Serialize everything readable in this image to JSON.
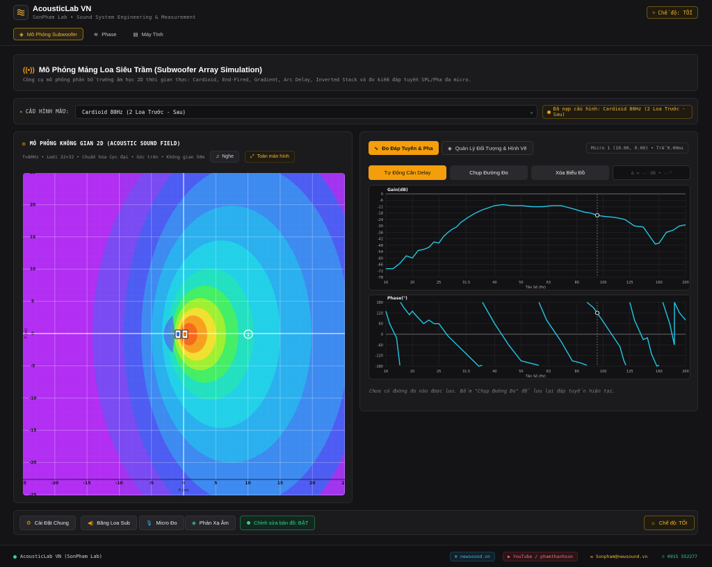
{
  "app": {
    "title": "AcousticLab VN",
    "subtitle": "SonPham Lab • Sound System Engineering & Measurement",
    "mode_label": "Chế độ: TỐI"
  },
  "nav": {
    "tabs": [
      {
        "label": "Mô Phỏng Subwoofer",
        "icon": "layers-icon",
        "active": true
      },
      {
        "label": "Phase",
        "icon": "wave-icon",
        "active": false
      },
      {
        "label": "Máy Tính",
        "icon": "calculator-icon",
        "active": false
      }
    ]
  },
  "header": {
    "title": "Mô Phỏng Mảng Loa Siêu Trầm (Subwoofer Array Simulation)",
    "description": "Công cụ mô phỏng phân bố trường âm học 2D thời gian thực: Cardioid, End-Fired, Gradient, Arc Delay, Inverted Stack và đo kiểm đáp tuyến SPL/Pha đa micro."
  },
  "config": {
    "label": "CẤU HÌNH MẪU:",
    "selected": "Cardioid 80Hz (2 Loa Trước - Sau)",
    "status": "Đã nạp cấu hình: Cardioid 80Hz (2 Loa Trước - Sau)"
  },
  "field_panel": {
    "title": "MÔ PHỎNG KHÔNG GIAN 2D (ACOUSTIC SOUND FIELD)",
    "info": "f=80Hz • Lưới 32×32 • Chuẩn hóa Cực đại • Góc trên • Không gian 50m",
    "listen_label": "Nghe",
    "fullscreen_label": "Toàn màn hình",
    "x_ticks": [
      "-25",
      "-20",
      "-15",
      "-10",
      "-5",
      "0",
      "5",
      "10",
      "15",
      "20",
      "25"
    ],
    "y_ticks": [
      "25",
      "20",
      "15",
      "10",
      "5",
      "0",
      "-5",
      "-10",
      "-15",
      "-20",
      "-25"
    ],
    "x_axis_label": "X (m)",
    "y_axis_label": "Y (m)",
    "mic_label": "1"
  },
  "measure_panel": {
    "tab_response": "Đo Đáp Tuyến & Pha",
    "tab_objects": "Quản Lý Đối Tượng & Hình Vẽ",
    "badge": "Micro 1 (10.00, 0.00) • Trễ 0.00ms",
    "auto_delay": "Tự Động Căn Delay",
    "capture": "Chụp Đường Đo",
    "clear": "Xóa Biểu Đồ",
    "input_placeholder": "Δ = -- dB • --°",
    "empty_msg": "Chưa có đường đo nào được lưu. Bấm \"Chụp Đường Đo\" để lưu lại đáp tuyến hiện tại."
  },
  "chart_data": [
    {
      "type": "line",
      "ylabel": "Gain(dB)",
      "xlabel": "Tần Số (Hz)",
      "x_ticks": [
        "16",
        "20",
        "25",
        "31.5",
        "40",
        "50",
        "63",
        "80",
        "100",
        "125",
        "160",
        "200"
      ],
      "y_ticks": [
        0,
        -6,
        -12,
        -18,
        -24,
        -30,
        -36,
        -42,
        -48,
        -54,
        -60,
        -66,
        -72,
        -78
      ],
      "ylim": [
        -78,
        0
      ],
      "marker_x": 95,
      "series": [
        {
          "x": [
            16,
            17,
            18,
            19,
            20,
            21,
            22,
            23,
            24,
            25,
            26,
            27,
            28,
            29,
            30,
            32,
            34,
            36,
            38,
            40,
            43,
            46,
            50,
            55,
            60,
            65,
            70,
            75,
            80,
            85,
            90,
            95,
            100,
            110,
            120,
            130,
            140,
            150,
            155,
            160,
            165,
            170,
            180,
            190,
            200
          ],
          "values": [
            -70,
            -70,
            -65,
            -58,
            -60,
            -53,
            -52,
            -50,
            -45,
            -46,
            -40,
            -36,
            -33,
            -31,
            -27,
            -22,
            -18,
            -15,
            -13,
            -11,
            -10,
            -11,
            -11,
            -12,
            -12,
            -11,
            -11,
            -13,
            -15,
            -17,
            -18,
            -20,
            -21,
            -22,
            -24,
            -30,
            -31,
            -42,
            -47,
            -46,
            -41,
            -36,
            -34,
            -30,
            -29
          ]
        }
      ]
    },
    {
      "type": "line",
      "ylabel": "Phase(°)",
      "xlabel": "Tần Số (Hz)",
      "x_ticks": [
        "16",
        "20",
        "25",
        "31.5",
        "40",
        "50",
        "63",
        "80",
        "100",
        "125",
        "160",
        "200"
      ],
      "y_ticks": [
        180,
        120,
        60,
        0,
        -60,
        -120,
        -180
      ],
      "ylim": [
        -180,
        180
      ],
      "marker_x": 95,
      "series": [
        {
          "x": [
            16,
            16.5,
            17.5,
            18,
            18.1,
            18.6,
            19.5,
            20,
            20.5,
            22,
            23,
            24,
            25,
            27,
            31,
            35,
            36,
            36.1,
            40,
            45,
            50,
            58,
            58.1,
            62,
            70,
            77,
            82,
            87,
            87.1,
            92,
            100,
            115,
            119,
            121,
            125,
            130,
            140,
            145,
            150,
            157,
            160,
            165,
            175,
            182,
            182.1,
            190,
            200
          ],
          "values": [
            130,
            60,
            -20,
            -175,
            180,
            150,
            110,
            130,
            110,
            60,
            80,
            60,
            60,
            -10,
            -100,
            -180,
            -175,
            180,
            60,
            -60,
            -150,
            -175,
            180,
            80,
            -40,
            -150,
            -160,
            -175,
            180,
            150,
            70,
            -70,
            -150,
            -175,
            180,
            80,
            -30,
            -20,
            -110,
            -180,
            -175,
            180,
            60,
            -60,
            180,
            120,
            80
          ]
        }
      ]
    }
  ],
  "bottom": {
    "general": "Cài Đặt Chung",
    "subs": "Băng Loa Sub",
    "mic": "Micro Đo",
    "reflect": "Phản Xạ Âm",
    "edit_map": "Chỉnh sửa bản đồ: BẬT",
    "mode": "Chế độ: TỐI"
  },
  "footer": {
    "brand": "AcousticLab VN (SonPham Lab)",
    "website": "newsound.vn",
    "youtube": "YouTube / phamthanhson",
    "email": "Sonpham@newsound.vn",
    "phone": "0915 552277"
  },
  "colors": {
    "accent": "#f59e0b",
    "green": "#34d399",
    "cyan": "#22c8e6",
    "magenta": "#cc33ff"
  }
}
